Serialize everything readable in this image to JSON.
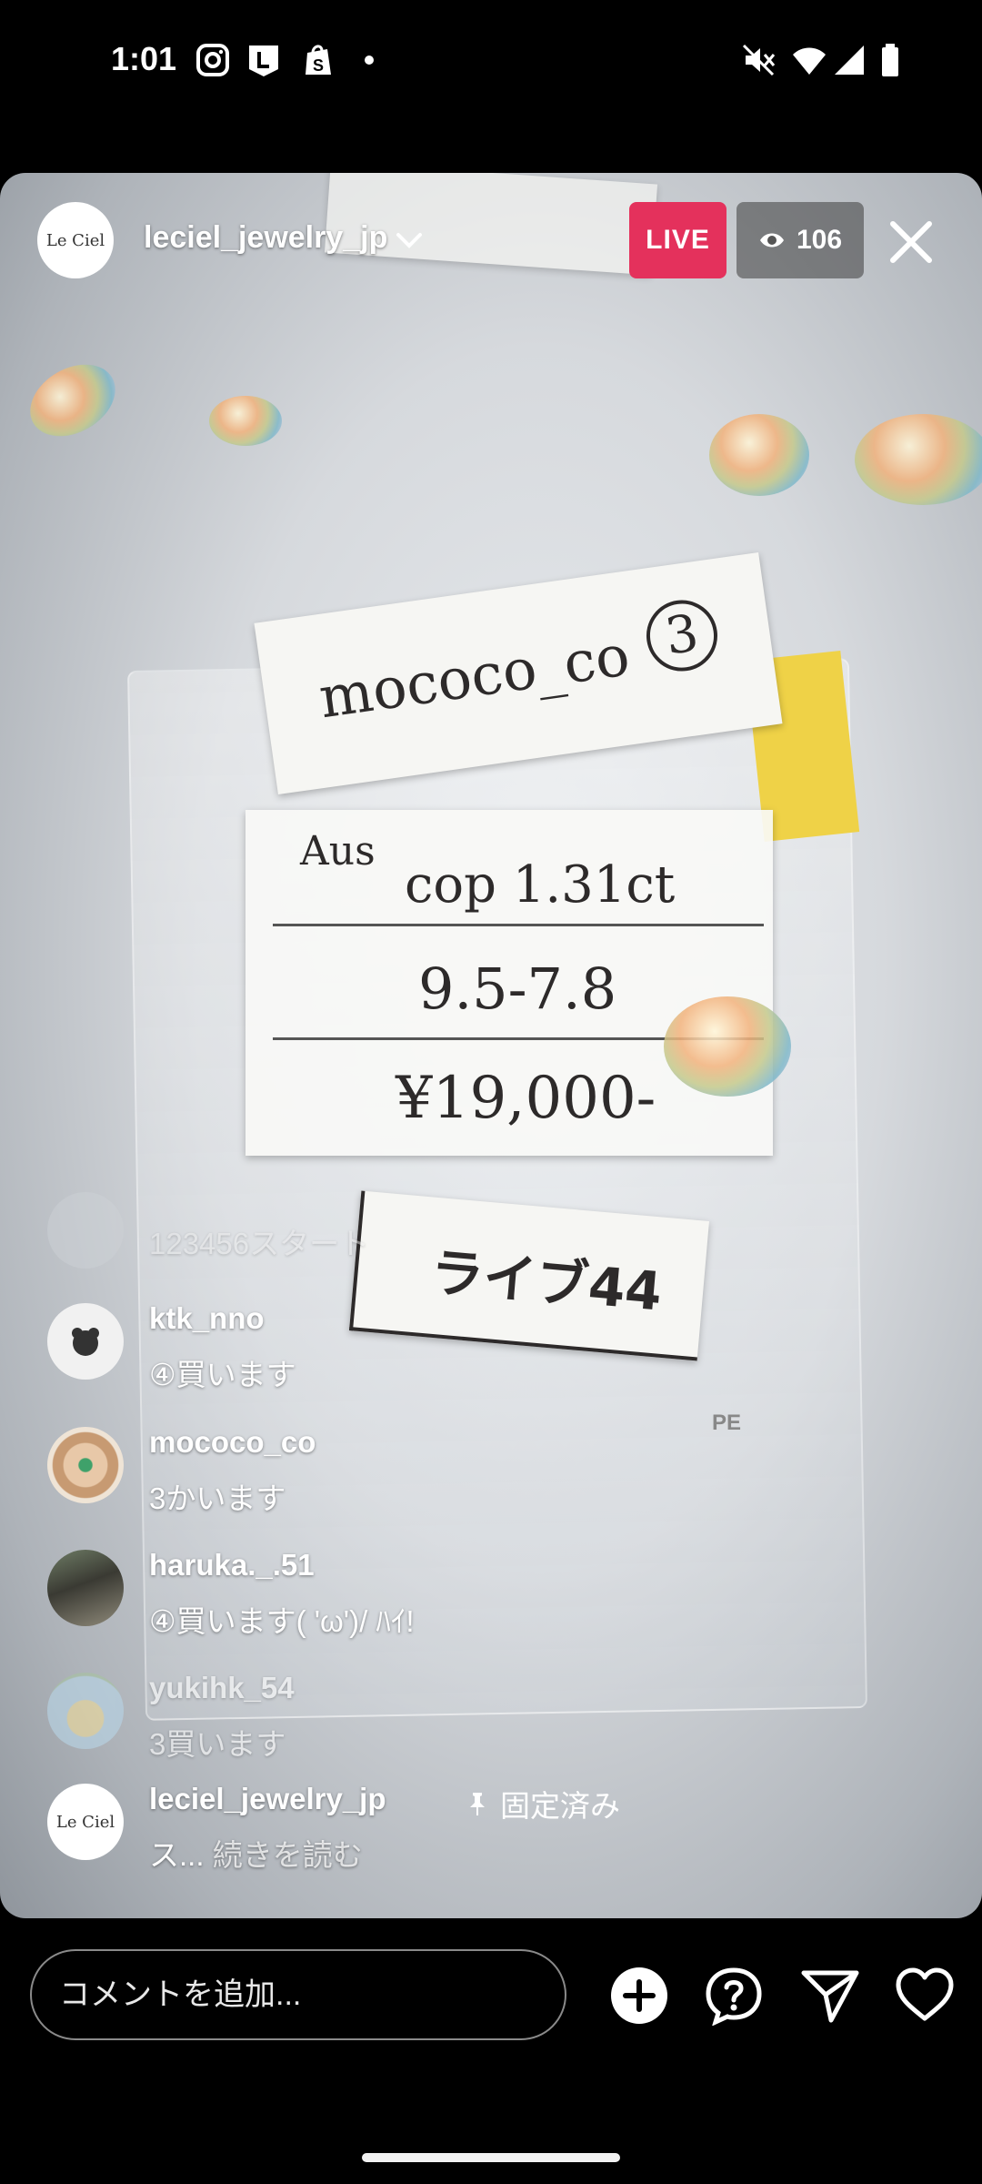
{
  "status_bar": {
    "time": "1:01",
    "icons_left": [
      "instagram-icon",
      "l-app-icon",
      "shopify-icon",
      "dot-icon"
    ],
    "icons_right": [
      "mute-icon",
      "wifi-icon",
      "signal-icon",
      "battery-icon"
    ]
  },
  "header": {
    "avatar_text": "Le Ciel",
    "username": "leciel_jewelry_jp",
    "live_label": "LIVE",
    "viewer_count": "106"
  },
  "scene_text": {
    "card_name": "mococo_co",
    "card_num": "3",
    "origin": "Aus",
    "stone": "cop 1.31ct",
    "size": "9.5-7.8",
    "price": "¥19,000-",
    "live_label": "ライブ44",
    "recycle": "PE"
  },
  "comments": [
    {
      "user": "",
      "message": "123456スタート",
      "faded": true
    },
    {
      "user": "ktk_nno",
      "message": "④買います"
    },
    {
      "user": "mococo_co",
      "message": "3かいます"
    },
    {
      "user": "haruka._.51",
      "message": "④買います( 'ω')/ ﾊｲ!"
    },
    {
      "user": "yukihk_54",
      "message": "3買います",
      "faded": true
    }
  ],
  "pinned_comment": {
    "user": "leciel_jewelry_jp",
    "pinned_label": "固定済み",
    "message": "ス...",
    "read_more": "続きを読む",
    "avatar_text": "Le Ciel"
  },
  "bottom_bar": {
    "comment_placeholder": "コメントを追加..."
  },
  "colors": {
    "live_red": "#e4315c",
    "background": "#000000"
  }
}
